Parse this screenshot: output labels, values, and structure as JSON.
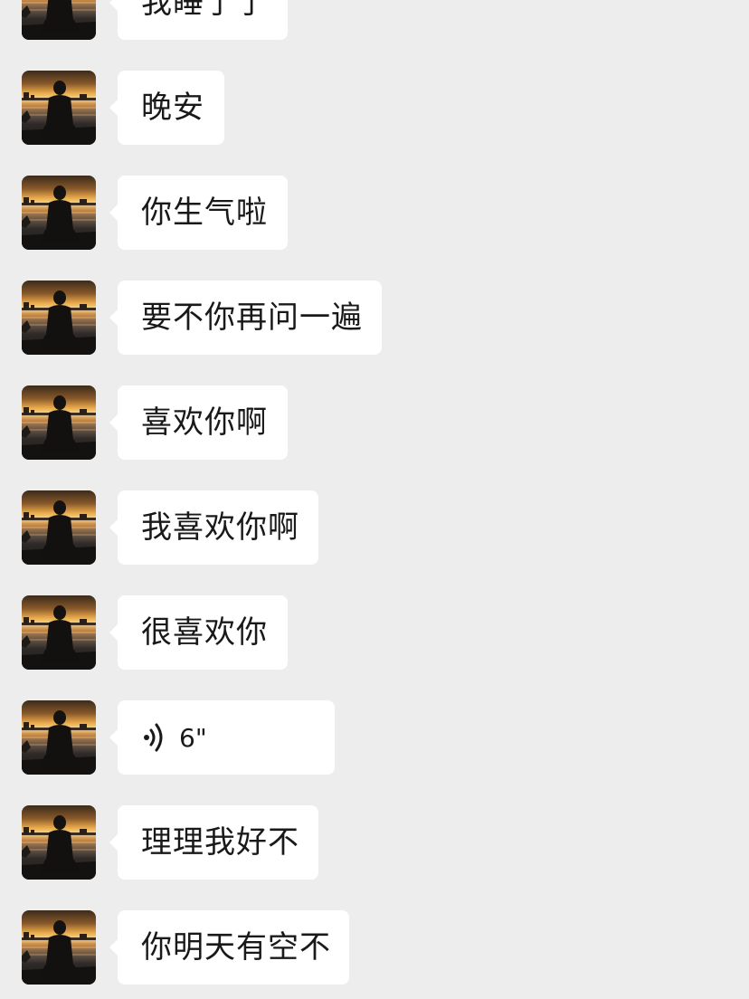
{
  "chat": {
    "messages": [
      {
        "type": "text",
        "text": "我睡了了"
      },
      {
        "type": "text",
        "text": "晚安"
      },
      {
        "type": "text",
        "text": "你生气啦"
      },
      {
        "type": "text",
        "text": "要不你再问一遍"
      },
      {
        "type": "text",
        "text": "喜欢你啊"
      },
      {
        "type": "text",
        "text": "我喜欢你啊"
      },
      {
        "type": "text",
        "text": "很喜欢你"
      },
      {
        "type": "voice",
        "duration": "6\"",
        "icon": "voice-wave-icon"
      },
      {
        "type": "text",
        "text": "理理我好不"
      },
      {
        "type": "text",
        "text": "你明天有空不"
      }
    ]
  },
  "colors": {
    "background": "#ededed",
    "bubble": "#ffffff",
    "text": "#191919"
  }
}
